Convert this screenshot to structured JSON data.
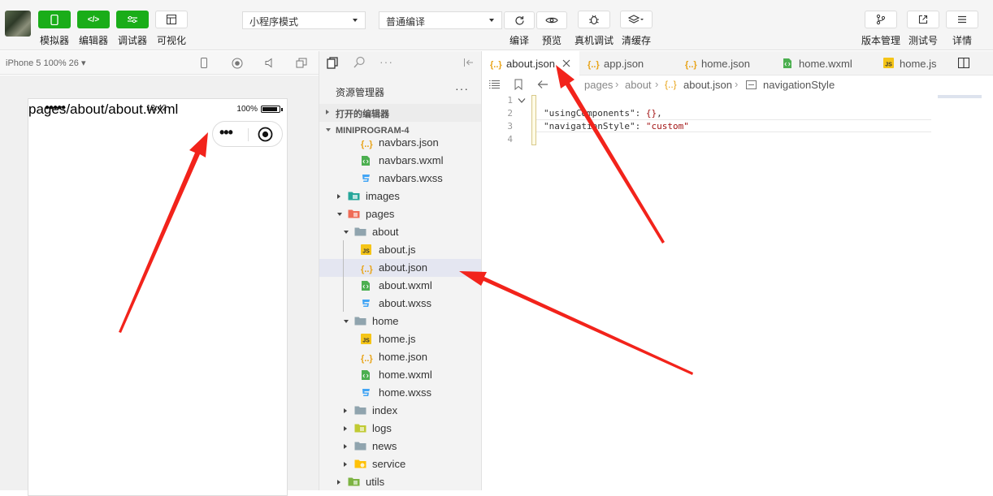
{
  "toolbar": {
    "simulator_label": "模拟器",
    "editor_label": "编辑器",
    "debugger_label": "调试器",
    "visual_label": "可视化",
    "mode_select": "小程序模式",
    "compile_select": "普通编译",
    "compile_label": "编译",
    "preview_label": "预览",
    "remote_debug_label": "真机调试",
    "clear_cache_label": "清缓存",
    "version_label": "版本管理",
    "test_id_label": "测试号",
    "details_label": "详情"
  },
  "simulator": {
    "device": "iPhone 5 100% 26 ▾",
    "status_dots": "●●●●●",
    "status_time": "13:42",
    "battery_text": "100%",
    "page_path": "pages/about/about.wxml",
    "capsule_more": "•••"
  },
  "explorer": {
    "title": "资源管理器",
    "more": "···",
    "open_editors": "打开的编辑器",
    "project": "MINIPROGRAM-4",
    "items": [
      {
        "label": "navbars.json",
        "type": "json"
      },
      {
        "label": "navbars.wxml",
        "type": "wxml"
      },
      {
        "label": "navbars.wxss",
        "type": "wxss"
      },
      {
        "label": "images",
        "type": "folder-images"
      },
      {
        "label": "pages",
        "type": "folder-pages"
      },
      {
        "label": "about",
        "type": "folder"
      },
      {
        "label": "about.js",
        "type": "js"
      },
      {
        "label": "about.json",
        "type": "json"
      },
      {
        "label": "about.wxml",
        "type": "wxml"
      },
      {
        "label": "about.wxss",
        "type": "wxss"
      },
      {
        "label": "home",
        "type": "folder"
      },
      {
        "label": "home.js",
        "type": "js"
      },
      {
        "label": "home.json",
        "type": "json"
      },
      {
        "label": "home.wxml",
        "type": "wxml"
      },
      {
        "label": "home.wxss",
        "type": "wxss"
      },
      {
        "label": "index",
        "type": "folder"
      },
      {
        "label": "logs",
        "type": "folder-logs"
      },
      {
        "label": "news",
        "type": "folder"
      },
      {
        "label": "service",
        "type": "folder-service"
      },
      {
        "label": "utils",
        "type": "folder-utils"
      }
    ]
  },
  "tabs": [
    {
      "label": "about.json",
      "type": "json",
      "active": true
    },
    {
      "label": "app.json",
      "type": "json"
    },
    {
      "label": "home.json",
      "type": "json"
    },
    {
      "label": "home.wxml",
      "type": "wxml"
    },
    {
      "label": "home.js",
      "type": "js"
    }
  ],
  "breadcrumb": {
    "part1": "pages",
    "part2": "about",
    "part3": "about.json",
    "part4": "navigationStyle"
  },
  "code": {
    "line_numbers": [
      "1",
      "2",
      "3",
      "4"
    ],
    "key1": "\"usingComponents\"",
    "val1": "{}",
    "key2": "\"navigationStyle\"",
    "val2": "\"custom\""
  },
  "colors": {
    "accent_green": "#1aad19",
    "annotation_red": "#f2231b",
    "json_icon": "#e8a317",
    "wxml_icon": "#4caf50",
    "wxss_icon": "#42a5f5",
    "js_icon": "#f5c518"
  }
}
